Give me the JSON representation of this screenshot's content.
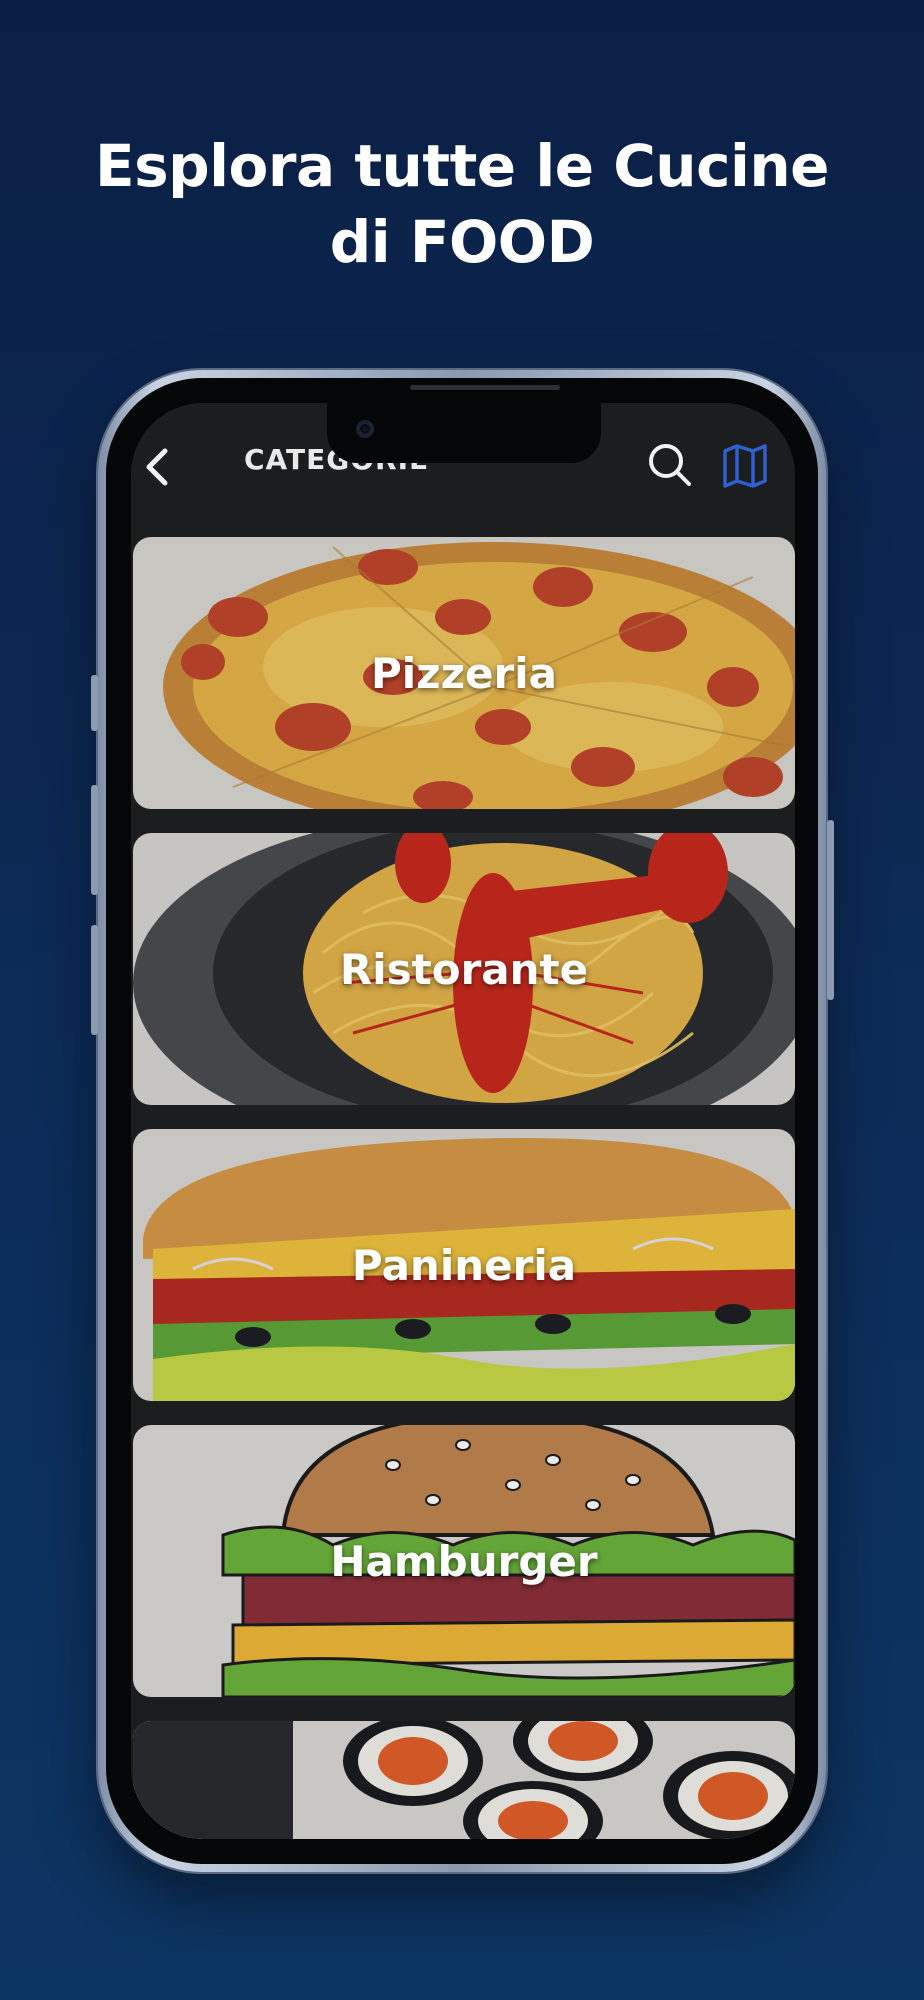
{
  "promo": {
    "headline_line1": "Esplora tutte le Cucine",
    "headline_line2": "di FOOD"
  },
  "app": {
    "header": {
      "title": "CATEGORIE",
      "back_icon": "chevron-left-icon",
      "search_icon": "search-icon",
      "map_icon": "map-icon"
    },
    "categories": [
      {
        "label": "Pizzeria"
      },
      {
        "label": "Ristorante"
      },
      {
        "label": "Panineria"
      },
      {
        "label": "Hamburger"
      },
      {
        "label": ""
      }
    ]
  },
  "colors": {
    "background_top": "#0b1f45",
    "background_bottom": "#0d3563",
    "map_icon_accent": "#2f5fd0",
    "screen_bg": "#1c1d1f"
  }
}
